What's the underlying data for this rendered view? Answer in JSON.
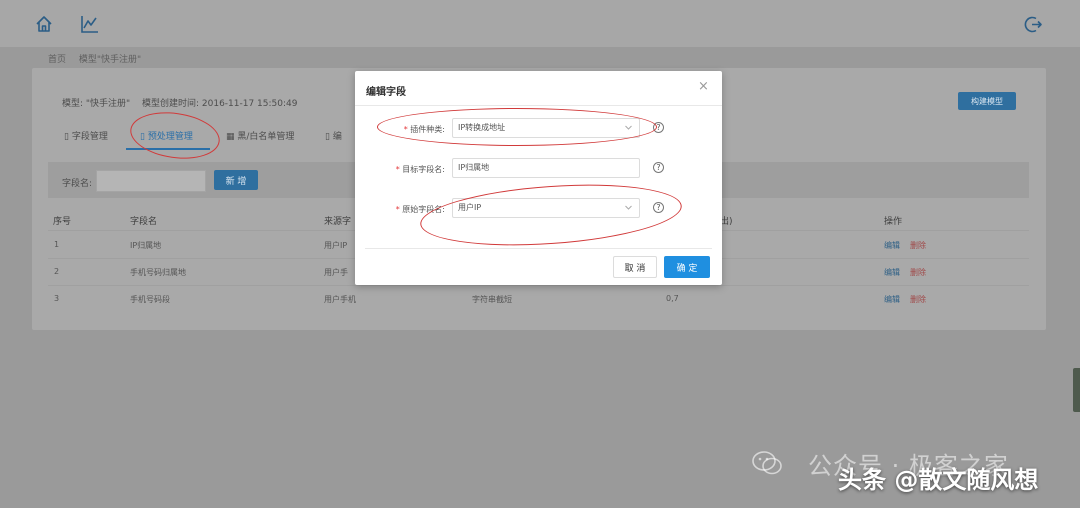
{
  "breadcrumb": {
    "home": "首页",
    "current": "模型\"快手注册\""
  },
  "model_meta": {
    "name_label": "模型: \"快手注册\"",
    "created_label": "模型创建时间: 2016-11-17 15:50:49"
  },
  "tabs": [
    {
      "label": "字段管理",
      "icon": "document-icon",
      "active": false
    },
    {
      "label": "预处理管理",
      "icon": "document-icon",
      "active": true
    },
    {
      "label": "黑/白名单管理",
      "icon": "grid-icon",
      "active": false
    },
    {
      "label": "编",
      "icon": "document-icon",
      "active": false
    }
  ],
  "rebuild_button": "构建模型",
  "filter": {
    "label": "字段名:",
    "value": "",
    "add_button": "新 增"
  },
  "table": {
    "headers": [
      "序号",
      "字段名",
      "来源字",
      "",
      "出)",
      "操作"
    ],
    "rows": [
      {
        "index": "1",
        "field": "IP归属地",
        "source": "用户IP",
        "c4": "",
        "c5": "",
        "edit": "编辑",
        "delete": "删除"
      },
      {
        "index": "2",
        "field": "手机号码归属地",
        "source": "用户手",
        "c4": "",
        "c5": "",
        "edit": "编辑",
        "delete": "删除"
      },
      {
        "index": "3",
        "field": "手机号码段",
        "source": "用户手机",
        "c4": "字符串截短",
        "c5": "0,7",
        "edit": "编辑",
        "delete": "删除"
      }
    ]
  },
  "modal": {
    "title": "编辑字段",
    "close": "×",
    "fields": [
      {
        "label": "插件种类:",
        "value": "IP转换成地址",
        "required": true
      },
      {
        "label": "目标字段名:",
        "value": "IP归属地",
        "required": true
      },
      {
        "label": "原始字段名:",
        "value": "用户IP",
        "required": true
      }
    ],
    "help": "?",
    "cancel": "取 消",
    "ok": "确 定"
  },
  "watermark": {
    "line1": "公众号 · 极客之家",
    "line2": "头条 @散文随风想"
  },
  "colors": {
    "primary": "#1f8fe0",
    "annotation": "#d13a3a",
    "required": "#e4393c",
    "overlay": "#9a9a9a"
  }
}
